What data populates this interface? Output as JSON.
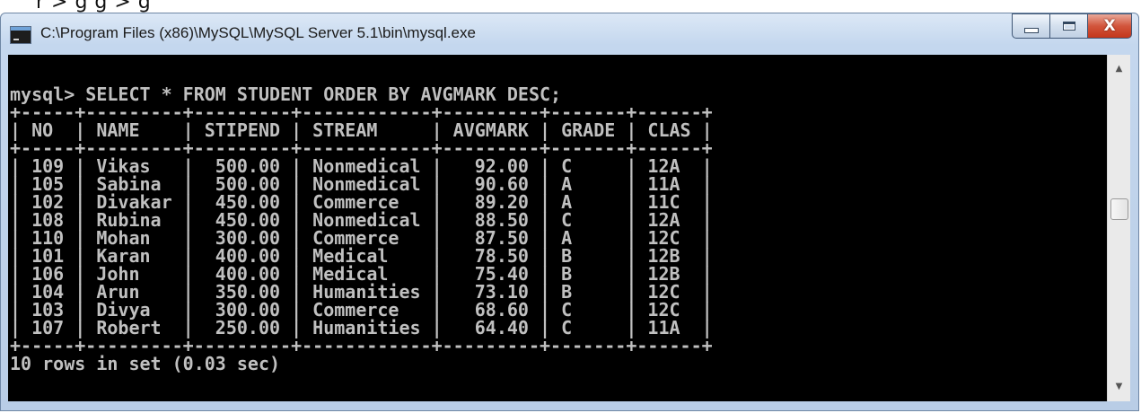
{
  "window": {
    "title": "C:\\Program Files (x86)\\MySQL\\MySQL Server 5.1\\bin\\mysql.exe",
    "icon": "console-icon",
    "buttons": {
      "minimize": "minimize-icon",
      "maximize": "maximize-icon",
      "close": "X"
    }
  },
  "caption_fragment": "r > g          g  >   g",
  "console": {
    "lines": [
      "mysql> SELECT * FROM STUDENT ORDER BY AVGMARK DESC;",
      "+-----+---------+---------+------------+---------+-------+------+",
      "| NO  | NAME    | STIPEND | STREAM     | AVGMARK | GRADE | CLAS |",
      "+-----+---------+---------+------------+---------+-------+------+",
      "| 109 | Vikas   |  500.00 | Nonmedical |   92.00 | C     | 12A  |",
      "| 105 | Sabina  |  500.00 | Nonmedical |   90.60 | A     | 11A  |",
      "| 102 | Divakar |  450.00 | Commerce   |   89.20 | A     | 11C  |",
      "| 108 | Rubina  |  450.00 | Nonmedical |   88.50 | C     | 12A  |",
      "| 110 | Mohan   |  300.00 | Commerce   |   87.50 | A     | 12C  |",
      "| 101 | Karan   |  400.00 | Medical    |   78.50 | B     | 12B  |",
      "| 106 | John    |  400.00 | Medical    |   75.40 | B     | 12B  |",
      "| 104 | Arun    |  350.00 | Humanities |   73.10 | B     | 12C  |",
      "| 103 | Divya   |  300.00 | Commerce   |   68.60 | C     | 12C  |",
      "| 107 | Robert  |  250.00 | Humanities |   64.40 | C     | 11A  |",
      "+-----+---------+---------+------------+---------+-------+------+",
      "10 rows in set (0.03 sec)"
    ]
  },
  "scrollbar": {
    "up_icon": "scroll-up-arrow-icon",
    "down_icon": "scroll-down-arrow-icon"
  },
  "colors": {
    "console_bg": "#000000",
    "console_text": "#c0c0c0",
    "close_button": "#c3361b"
  }
}
